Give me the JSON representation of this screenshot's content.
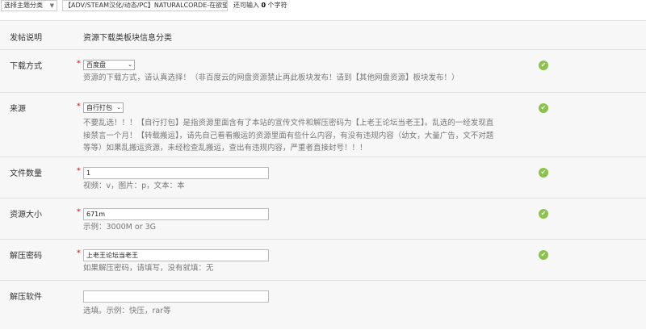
{
  "topbar": {
    "category_select": "选择主题分类",
    "title_value": "【ADV/STEAM汉化/动态/PC】NATURALCORDE-在欲望的",
    "hint_prefix": "还可输入",
    "hint_count": "0",
    "hint_suffix": "个字符"
  },
  "form": {
    "header_left": "发帖说明",
    "header_right": "资源下载类板块信息分类",
    "fields": [
      {
        "label": "下载方式",
        "required": "*",
        "value": "百度盘",
        "description": "资源的下载方式，请认真选择！（非百度云的网盘资源禁止再此板块发布！请到【其他网盘资源】板块发布！）"
      },
      {
        "label": "来源",
        "required": "*",
        "value": "自行打包",
        "description_lines": [
          "不要乱选！！！【自行打包】是指资源里面含有了本站的宣传文件和解压密码为【上老王论坛当老王】。乱选的一经发现直",
          "接禁言一个月！【转载搬运】，请先自己看看搬运的资源里面有些什么内容，有没有违规内容（幼女，大量广告，文不对题",
          "等等）如果乱搬运资源，未经检查乱搬运，查出有违规内容，严重者直接封号！！！"
        ]
      },
      {
        "label": "文件数量",
        "required": "*",
        "value": "1",
        "description": "视频：v，图片：p，文本：本"
      },
      {
        "label": "资源大小",
        "required": "*",
        "value": "671m",
        "description": "示例：3000M or 3G"
      },
      {
        "label": "解压密码",
        "required": "*",
        "value": "上老王论坛当老王",
        "description": "如果解压密码，请填写，没有就填：无"
      },
      {
        "label": "解压软件",
        "required": "",
        "value": "",
        "description": "选填。示例：快压，rar等"
      }
    ],
    "ok_icon": "✔"
  }
}
